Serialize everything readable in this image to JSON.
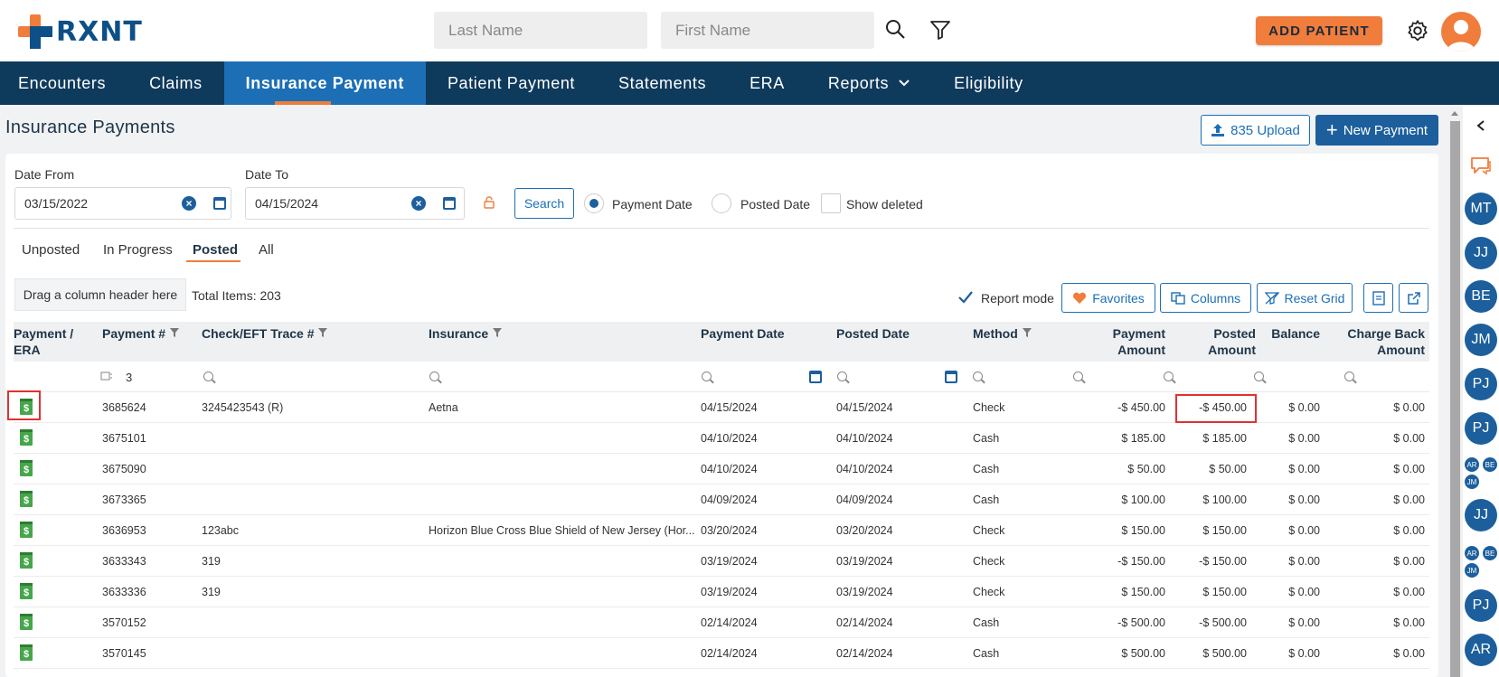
{
  "header": {
    "brand": "RXNT",
    "last_name_placeholder": "Last Name",
    "first_name_placeholder": "First Name",
    "add_patient": "ADD PATIENT"
  },
  "nav": {
    "items": [
      "Encounters",
      "Claims",
      "Insurance Payment",
      "Patient Payment",
      "Statements",
      "ERA",
      "Reports",
      "Eligibility"
    ],
    "active": "Insurance Payment"
  },
  "page": {
    "title": "Insurance Payments",
    "upload_button": "835 Upload",
    "new_payment_button": "New Payment"
  },
  "filters": {
    "date_from_label": "Date From",
    "date_from": "03/15/2022",
    "date_to_label": "Date To",
    "date_to": "04/15/2024",
    "search_button": "Search",
    "payment_date_label": "Payment Date",
    "posted_date_label": "Posted Date",
    "show_deleted_label": "Show deleted",
    "payment_date_selected": true
  },
  "tabs": {
    "items": [
      "Unposted",
      "In Progress",
      "Posted",
      "All"
    ],
    "active": "Posted"
  },
  "toolbar": {
    "drag_hint": "Drag a column header here",
    "total_items": "Total Items: 203",
    "report_mode": "Report mode",
    "favorites": "Favorites",
    "columns": "Columns",
    "reset_grid": "Reset Grid"
  },
  "grid": {
    "headers": {
      "payment_era_1": "Payment /",
      "payment_era_2": "ERA",
      "payment_no": "Payment #",
      "check_trace": "Check/EFT Trace #",
      "insurance": "Insurance",
      "payment_date": "Payment Date",
      "posted_date": "Posted Date",
      "method": "Method",
      "payment_amount_1": "Payment",
      "payment_amount_2": "Amount",
      "posted_amount_1": "Posted",
      "posted_amount_2": "Amount",
      "balance": "Balance",
      "chargeback_1": "Charge Back",
      "chargeback_2": "Amount"
    },
    "filter_payment_no": "3",
    "rows": [
      {
        "payment_no": "3685624",
        "trace": "3245423543 (R)",
        "insurance": "Aetna",
        "payment_date": "04/15/2024",
        "posted_date": "04/15/2024",
        "method": "Check",
        "payment_amount": "-$ 450.00",
        "posted_amount": "-$ 450.00",
        "balance": "$ 0.00",
        "chargeback": "$ 0.00"
      },
      {
        "payment_no": "3675101",
        "trace": "",
        "insurance": "",
        "payment_date": "04/10/2024",
        "posted_date": "04/10/2024",
        "method": "Cash",
        "payment_amount": "$ 185.00",
        "posted_amount": "$ 185.00",
        "balance": "$ 0.00",
        "chargeback": "$ 0.00"
      },
      {
        "payment_no": "3675090",
        "trace": "",
        "insurance": "",
        "payment_date": "04/10/2024",
        "posted_date": "04/10/2024",
        "method": "Cash",
        "payment_amount": "$ 50.00",
        "posted_amount": "$ 50.00",
        "balance": "$ 0.00",
        "chargeback": "$ 0.00"
      },
      {
        "payment_no": "3673365",
        "trace": "",
        "insurance": "",
        "payment_date": "04/09/2024",
        "posted_date": "04/09/2024",
        "method": "Cash",
        "payment_amount": "$ 100.00",
        "posted_amount": "$ 100.00",
        "balance": "$ 0.00",
        "chargeback": "$ 0.00"
      },
      {
        "payment_no": "3636953",
        "trace": "123abc",
        "insurance": "Horizon Blue Cross Blue Shield of New Jersey (Hor...",
        "payment_date": "03/20/2024",
        "posted_date": "03/20/2024",
        "method": "Check",
        "payment_amount": "$ 150.00",
        "posted_amount": "$ 150.00",
        "balance": "$ 0.00",
        "chargeback": "$ 0.00"
      },
      {
        "payment_no": "3633343",
        "trace": "319",
        "insurance": "",
        "payment_date": "03/19/2024",
        "posted_date": "03/19/2024",
        "method": "Check",
        "payment_amount": "-$ 150.00",
        "posted_amount": "-$ 150.00",
        "balance": "$ 0.00",
        "chargeback": "$ 0.00"
      },
      {
        "payment_no": "3633336",
        "trace": "319",
        "insurance": "",
        "payment_date": "03/19/2024",
        "posted_date": "03/19/2024",
        "method": "Check",
        "payment_amount": "$ 150.00",
        "posted_amount": "$ 150.00",
        "balance": "$ 0.00",
        "chargeback": "$ 0.00"
      },
      {
        "payment_no": "3570152",
        "trace": "",
        "insurance": "",
        "payment_date": "02/14/2024",
        "posted_date": "02/14/2024",
        "method": "Cash",
        "payment_amount": "-$ 500.00",
        "posted_amount": "-$ 500.00",
        "balance": "$ 0.00",
        "chargeback": "$ 0.00"
      },
      {
        "payment_no": "3570145",
        "trace": "",
        "insurance": "",
        "payment_date": "02/14/2024",
        "posted_date": "02/14/2024",
        "method": "Cash",
        "payment_amount": "$ 500.00",
        "posted_amount": "$ 500.00",
        "balance": "$ 0.00",
        "chargeback": "$ 0.00"
      }
    ]
  },
  "sidebar": {
    "avatars": [
      "MT",
      "JJ",
      "BE",
      "JM",
      "PJ",
      "PJ",
      "JJ",
      "PJ",
      "AR"
    ],
    "group_1": [
      "AR",
      "BE",
      "JM"
    ],
    "group_2": [
      "AR",
      "BE",
      "JM"
    ]
  },
  "colors": {
    "nav_bg": "#0e3a5c",
    "nav_active": "#1c6fb5",
    "accent": "#f07d3c",
    "primary": "#1c5f9c",
    "highlight": "#e03131"
  }
}
